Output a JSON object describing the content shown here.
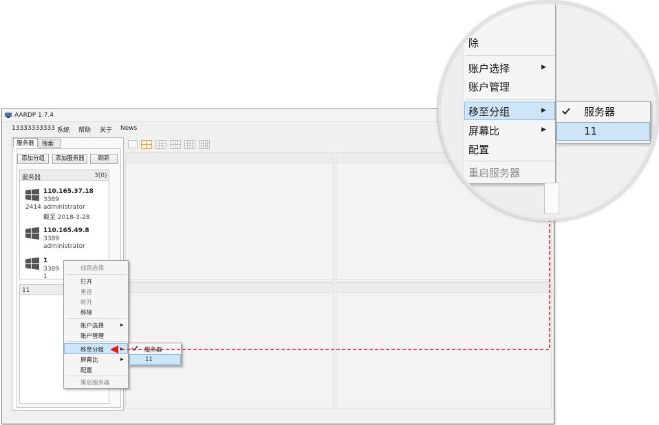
{
  "window": {
    "title": "AARDP 1.7.4"
  },
  "menubar": [
    "13333333333",
    "系统",
    "帮助",
    "关于",
    "News"
  ],
  "tabs": [
    "服务器",
    "搜索"
  ],
  "buttons": {
    "add_group": "添加分组",
    "add_server": "添加服务器",
    "refresh": "刷新"
  },
  "group1": {
    "name": "服务器",
    "count": "3(0)",
    "servers": [
      {
        "ip": "110.165.37.18",
        "port": "3389",
        "user": "administrator",
        "extra": "截至 2018-3-28",
        "id": "2414"
      },
      {
        "ip": "110.165.49.8",
        "port": "3389",
        "user": "administrator"
      },
      {
        "ip": "1",
        "port": "3389",
        "user": "1"
      }
    ]
  },
  "group2": {
    "name": "11"
  },
  "context_menu": {
    "items": [
      {
        "label": "线路选择",
        "disabled": true
      },
      {
        "label": "打开",
        "disabled": false
      },
      {
        "label": "重连",
        "disabled": true
      },
      {
        "label": "断开",
        "disabled": true
      },
      {
        "label": "移除",
        "disabled": false
      },
      {
        "label": "账户选择",
        "disabled": false,
        "submenu": true
      },
      {
        "label": "账户管理",
        "disabled": false
      },
      {
        "label": "移至分组",
        "disabled": false,
        "submenu": true,
        "highlighted": true
      },
      {
        "label": "屏幕比",
        "disabled": false,
        "submenu": true
      },
      {
        "label": "配置",
        "disabled": false
      },
      {
        "label": "重启服务器",
        "disabled": true
      }
    ]
  },
  "submenu": {
    "items": [
      {
        "label": "服务器",
        "checked": true
      },
      {
        "label": "11",
        "highlighted": true
      }
    ]
  },
  "zoom": {
    "items": [
      "移除",
      "账户选择",
      "账户管理",
      "移至分组",
      "屏幕比",
      "配置",
      "重启服务器"
    ],
    "zoom_removed_fragment": "除",
    "submenu": [
      "服务器",
      "11"
    ]
  },
  "colors": {
    "highlight": "#cde6f7",
    "highlight_border": "#7eb4ea",
    "arrow": "#e0191e",
    "grid_accent": "#f0a040"
  }
}
